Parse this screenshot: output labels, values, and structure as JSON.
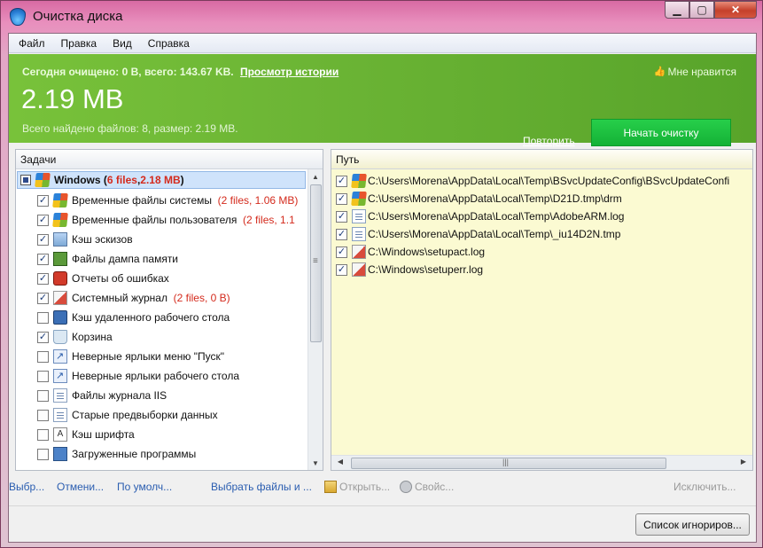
{
  "window": {
    "title": "Очистка диска"
  },
  "menu": [
    "Файл",
    "Правка",
    "Вид",
    "Справка"
  ],
  "banner": {
    "today_text": "Сегодня очищено: 0 B, всего: 143.67 KB.",
    "history_link": "Просмотр истории",
    "total_size": "2.19 MB",
    "found_text": "Всего найдено файлов: 8, размер: 2.19 MB.",
    "like_label": "Мне нравится",
    "repeat_link": "Повторить",
    "clean_button": "Начать очистку"
  },
  "tasks": {
    "header": "Задачи",
    "root": {
      "label": "Windows",
      "open": "(",
      "files": "6 files",
      "comma": ", ",
      "size": "2.18 MB",
      "close": ")"
    },
    "items": [
      {
        "label": "Временные файлы системы",
        "checked": true,
        "icon": "windows-icon",
        "info": "(2 files, 1.06 MB)"
      },
      {
        "label": "Временные файлы пользователя",
        "checked": true,
        "icon": "windows-icon",
        "info": "(2 files, 1.1"
      },
      {
        "label": "Кэш эскизов",
        "checked": true,
        "icon": "image-icon",
        "info": ""
      },
      {
        "label": "Файлы дампа памяти",
        "checked": true,
        "icon": "memory-icon",
        "info": ""
      },
      {
        "label": "Отчеты об ошибках",
        "checked": true,
        "icon": "error-report-icon",
        "info": ""
      },
      {
        "label": "Системный журнал",
        "checked": true,
        "icon": "log-icon",
        "info": "(2 files, 0 B)"
      },
      {
        "label": "Кэш удаленного рабочего стола",
        "checked": false,
        "icon": "remote-desktop-icon",
        "info": ""
      },
      {
        "label": "Корзина",
        "checked": true,
        "icon": "recycle-bin-icon",
        "info": ""
      },
      {
        "label": "Неверные ярлыки меню \"Пуск\"",
        "checked": false,
        "icon": "shortcut-icon",
        "info": ""
      },
      {
        "label": "Неверные ярлыки рабочего стола",
        "checked": false,
        "icon": "shortcut-icon",
        "info": ""
      },
      {
        "label": "Файлы журнала IIS",
        "checked": false,
        "icon": "document-icon",
        "info": ""
      },
      {
        "label": "Старые предвыборки данных",
        "checked": false,
        "icon": "document-icon",
        "info": ""
      },
      {
        "label": "Кэш шрифта",
        "checked": false,
        "icon": "font-icon",
        "info": ""
      },
      {
        "label": "Загруженные программы",
        "checked": false,
        "icon": "program-icon",
        "info": ""
      }
    ]
  },
  "paths": {
    "header": "Путь",
    "files": [
      {
        "path": "C:\\Users\\Morena\\AppData\\Local\\Temp\\BSvcUpdateConfig\\BSvcUpdateConfi",
        "icon": "windows-icon"
      },
      {
        "path": "C:\\Users\\Morena\\AppData\\Local\\Temp\\D21D.tmp\\drm",
        "icon": "windows-icon"
      },
      {
        "path": "C:\\Users\\Morena\\AppData\\Local\\Temp\\AdobeARM.log",
        "icon": "document-icon"
      },
      {
        "path": "C:\\Users\\Morena\\AppData\\Local\\Temp\\_iu14D2N.tmp",
        "icon": "document-icon"
      },
      {
        "path": "C:\\Windows\\setupact.log",
        "icon": "log-icon"
      },
      {
        "path": "C:\\Windows\\setuperr.log",
        "icon": "log-icon"
      }
    ]
  },
  "actions": {
    "select": "Выбр...",
    "cancel": "Отмени...",
    "default": "По умолч...",
    "choose_files": "Выбрать файлы и ...",
    "open": "Открыть...",
    "properties": "Свойс...",
    "exclude": "Исключить..."
  },
  "ignore_list_button": "Список игнориров..."
}
